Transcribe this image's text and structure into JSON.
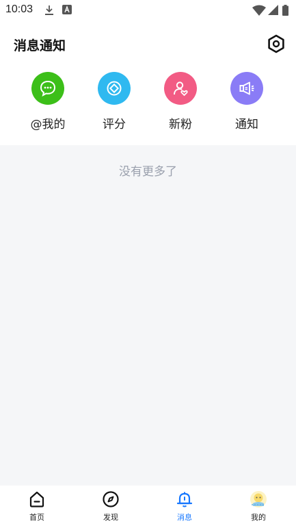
{
  "status_bar": {
    "time": "10:03",
    "left_icons": [
      "download-icon",
      "a-font-icon"
    ],
    "right_icons": [
      "wifi-icon",
      "signal-icon",
      "battery-icon"
    ]
  },
  "header": {
    "title": "消息通知",
    "settings_icon": "gear-icon"
  },
  "categories": [
    {
      "label": "@我的",
      "icon": "chat-bubble-icon",
      "color": "#3cbf19"
    },
    {
      "label": "评分",
      "icon": "rating-icon",
      "color": "#2fb9f0"
    },
    {
      "label": "新粉",
      "icon": "new-follower-icon",
      "color": "#f25b84"
    },
    {
      "label": "通知",
      "icon": "megaphone-icon",
      "color": "#8a7cf6"
    }
  ],
  "empty_state": {
    "text": "没有更多了"
  },
  "tabbar": {
    "active_color": "#1677ff",
    "tabs": [
      {
        "label": "首页",
        "icon": "home-icon",
        "active": false
      },
      {
        "label": "发现",
        "icon": "compass-icon",
        "active": false
      },
      {
        "label": "消息",
        "icon": "bell-icon",
        "active": true
      },
      {
        "label": "我的",
        "icon": "avatar-icon",
        "active": false
      }
    ]
  }
}
